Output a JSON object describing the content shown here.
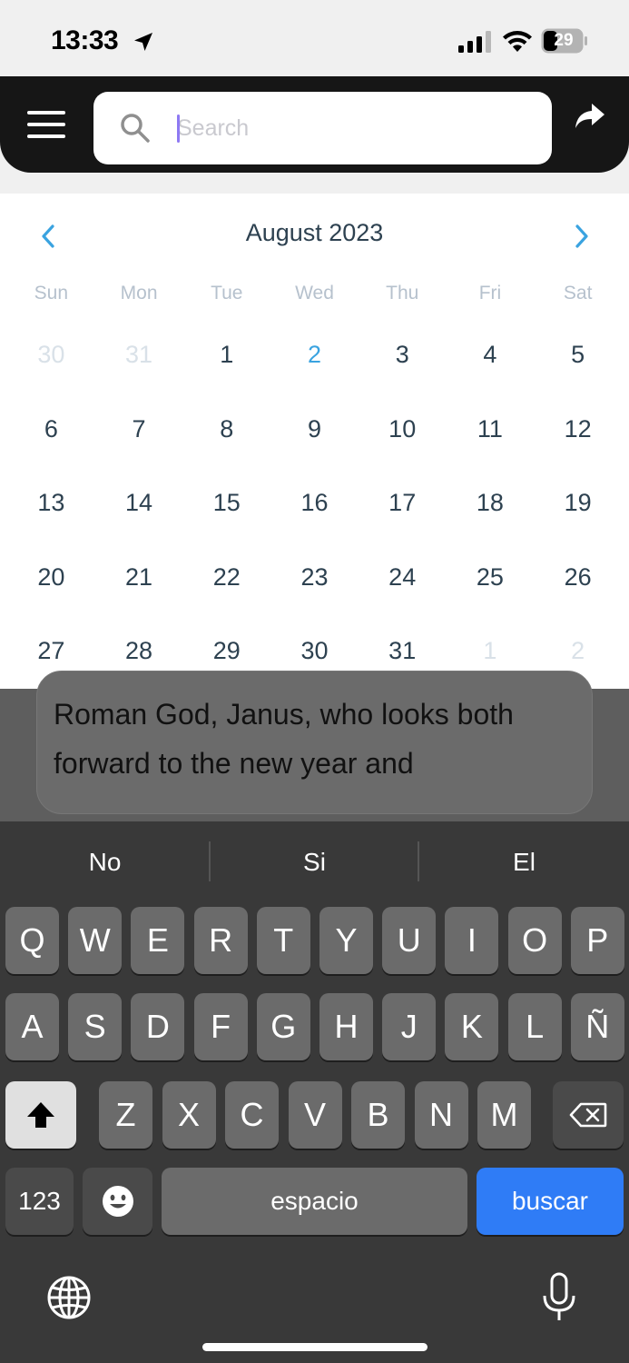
{
  "status_bar": {
    "time": "13:33",
    "battery": "29",
    "icons": [
      "location-arrow-icon",
      "signal-bars-icon",
      "wifi-icon",
      "battery-icon"
    ]
  },
  "header": {
    "menu_icon": "hamburger-icon",
    "search_placeholder": "Search",
    "search_value": "",
    "search_icon": "search-icon",
    "share_icon": "share-arrow-icon"
  },
  "calendar": {
    "month_title": "August 2023",
    "weekdays": [
      "Sun",
      "Mon",
      "Tue",
      "Wed",
      "Thu",
      "Fri",
      "Sat"
    ],
    "days": [
      {
        "label": "30",
        "state": "muted"
      },
      {
        "label": "31",
        "state": "muted"
      },
      {
        "label": "1",
        "state": "normal"
      },
      {
        "label": "2",
        "state": "today"
      },
      {
        "label": "3",
        "state": "normal"
      },
      {
        "label": "4",
        "state": "normal"
      },
      {
        "label": "5",
        "state": "normal"
      },
      {
        "label": "6",
        "state": "normal"
      },
      {
        "label": "7",
        "state": "normal"
      },
      {
        "label": "8",
        "state": "normal"
      },
      {
        "label": "9",
        "state": "normal"
      },
      {
        "label": "10",
        "state": "normal"
      },
      {
        "label": "11",
        "state": "normal"
      },
      {
        "label": "12",
        "state": "normal"
      },
      {
        "label": "13",
        "state": "normal"
      },
      {
        "label": "14",
        "state": "normal"
      },
      {
        "label": "15",
        "state": "normal"
      },
      {
        "label": "16",
        "state": "normal"
      },
      {
        "label": "17",
        "state": "normal"
      },
      {
        "label": "18",
        "state": "normal"
      },
      {
        "label": "19",
        "state": "normal"
      },
      {
        "label": "20",
        "state": "normal"
      },
      {
        "label": "21",
        "state": "normal"
      },
      {
        "label": "22",
        "state": "normal"
      },
      {
        "label": "23",
        "state": "normal"
      },
      {
        "label": "24",
        "state": "normal"
      },
      {
        "label": "25",
        "state": "normal"
      },
      {
        "label": "26",
        "state": "normal"
      },
      {
        "label": "27",
        "state": "normal"
      },
      {
        "label": "28",
        "state": "normal"
      },
      {
        "label": "29",
        "state": "normal"
      },
      {
        "label": "30",
        "state": "normal"
      },
      {
        "label": "31",
        "state": "normal"
      },
      {
        "label": "1",
        "state": "muted"
      },
      {
        "label": "2",
        "state": "muted"
      }
    ],
    "colors": {
      "text": "#2d4150",
      "muted": "#d9e1e8",
      "today": "#3aa3e0",
      "arrows": "#3aa3e0",
      "weekday": "#b6c1cd"
    }
  },
  "article": {
    "lines": [
      "Roman God, Janus, who looks both",
      "forward to the new year and"
    ]
  },
  "keyboard": {
    "suggestions": [
      "No",
      "Si",
      "El"
    ],
    "row1": [
      "Q",
      "W",
      "E",
      "R",
      "T",
      "Y",
      "U",
      "I",
      "O",
      "P"
    ],
    "row2": [
      "A",
      "S",
      "D",
      "F",
      "G",
      "H",
      "J",
      "K",
      "L",
      "Ñ"
    ],
    "row3": [
      "Z",
      "X",
      "C",
      "V",
      "B",
      "N",
      "M"
    ],
    "numbers_label": "123",
    "space_label": "espacio",
    "action_label": "buscar",
    "icons": [
      "shift-icon",
      "backspace-icon",
      "emoji-icon",
      "globe-icon",
      "microphone-icon"
    ],
    "action_color": "#2f7cf6"
  }
}
